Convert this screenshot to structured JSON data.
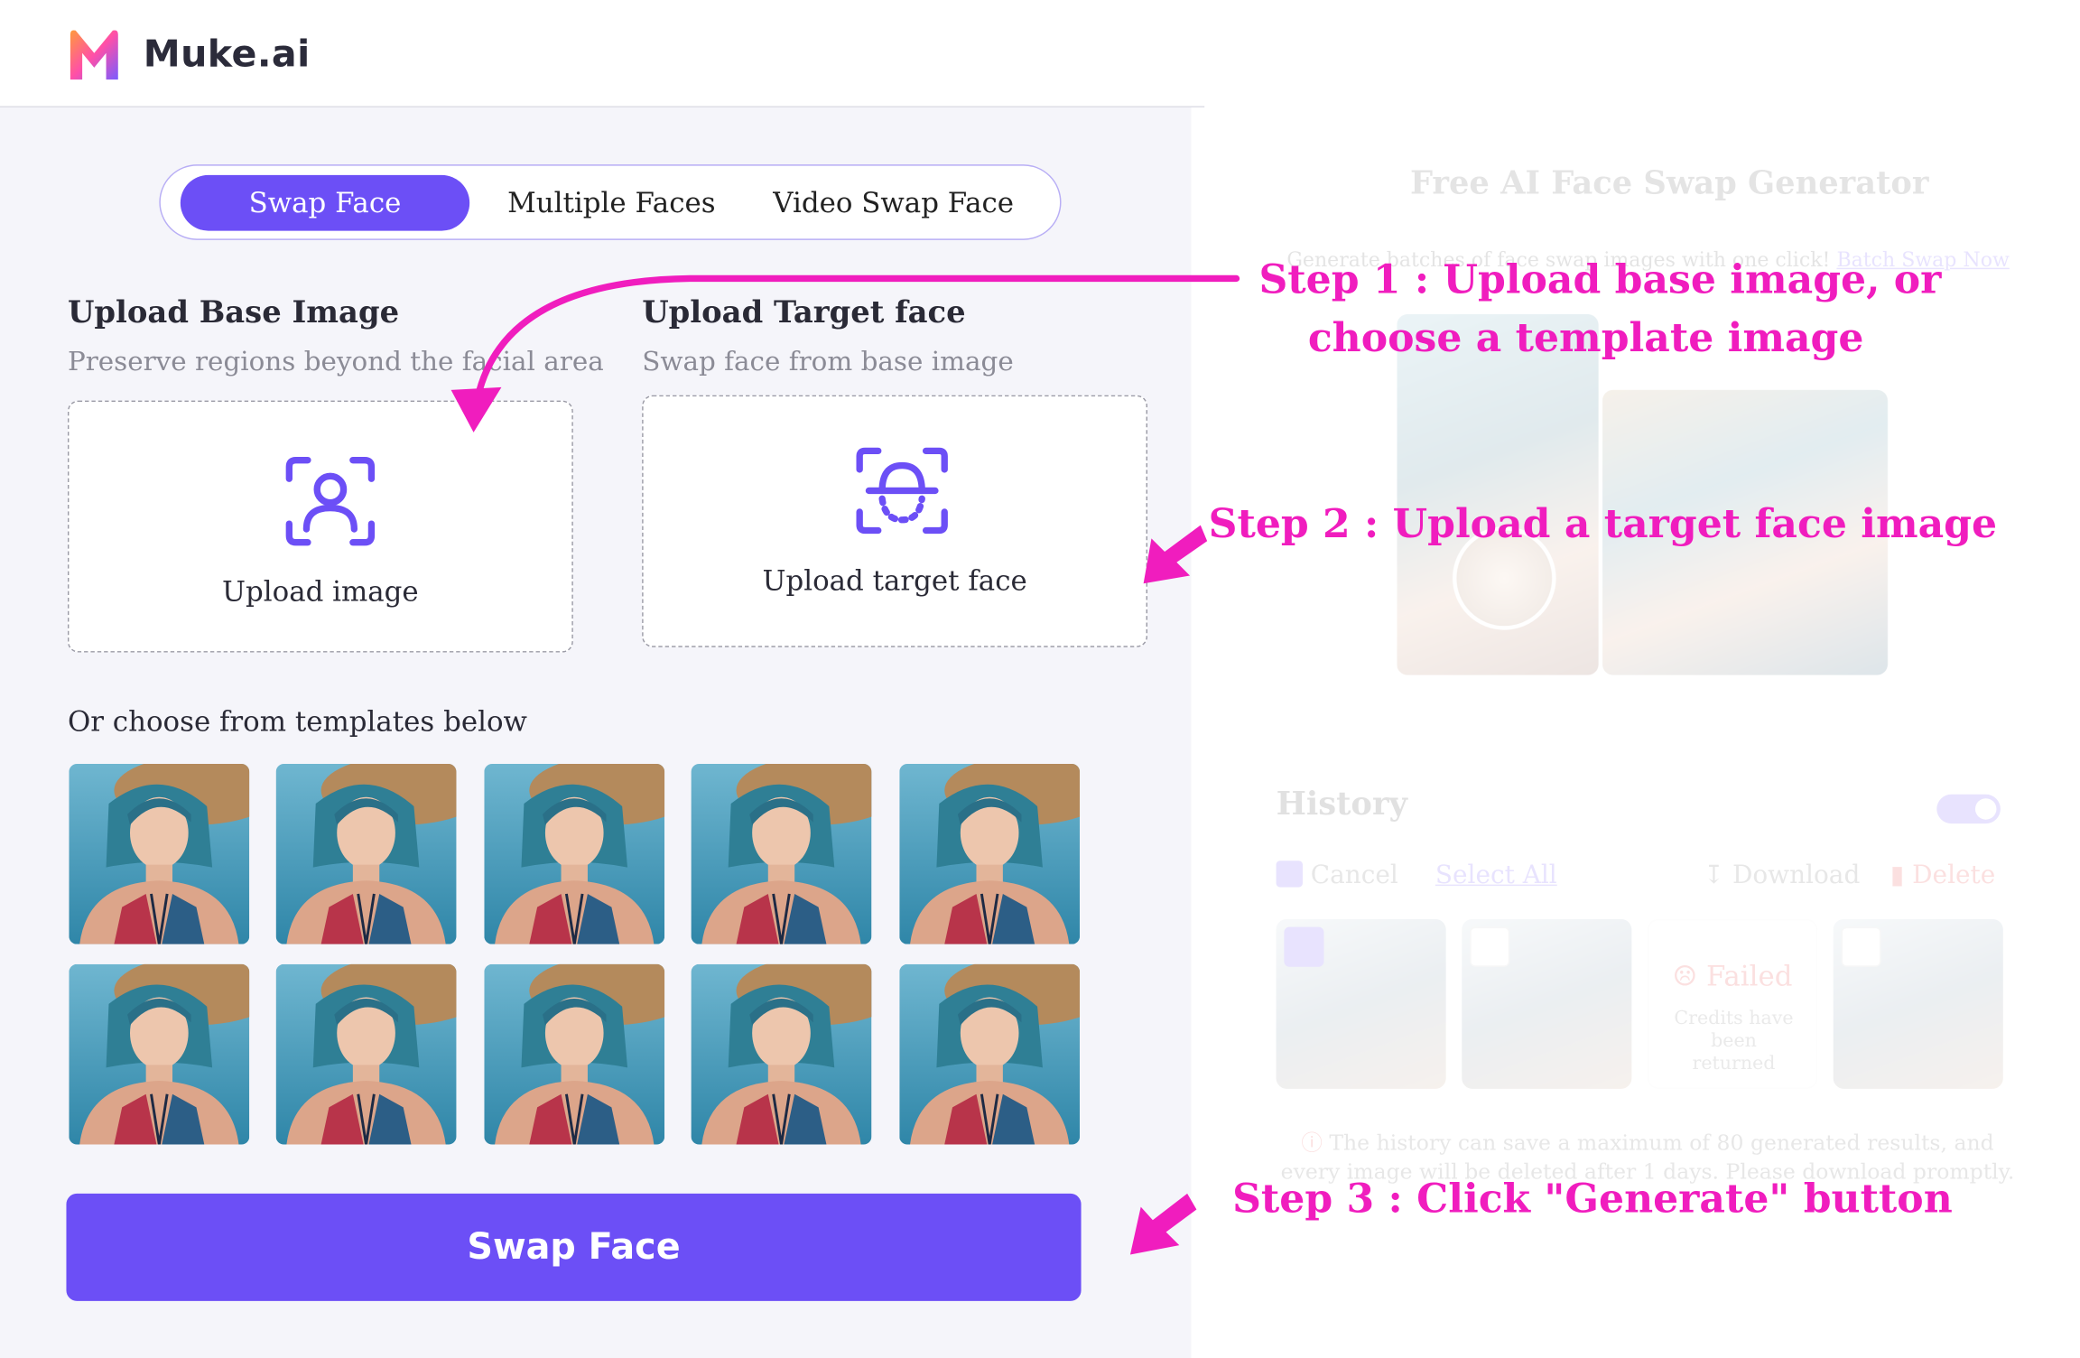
{
  "brand": {
    "name": "Muke.ai"
  },
  "tabs": [
    {
      "label": "Swap Face",
      "active": true
    },
    {
      "label": "Multiple Faces",
      "active": false
    },
    {
      "label": "Video Swap Face",
      "active": false
    }
  ],
  "base_upload": {
    "title": "Upload Base Image",
    "subtitle": "Preserve regions beyond the facial area",
    "label": "Upload image"
  },
  "target_upload": {
    "title": "Upload Target face",
    "subtitle": "Swap face from base image",
    "label": "Upload target face"
  },
  "templates": {
    "label": "Or choose from templates below",
    "count": 10
  },
  "primary_button": {
    "label": "Swap Face"
  },
  "right_panel": {
    "title": "Free AI Face Swap Generator",
    "promo_text": "Generate batches of face swap images with one click!",
    "promo_link": "Batch Swap Now",
    "history": {
      "title": "History",
      "cancel_label": "Cancel",
      "select_all_label": "Select All",
      "download_label": "Download",
      "delete_label": "Delete",
      "failed_label": "Failed",
      "failed_note": "Credits have been returned",
      "note": "The history can save a maximum of 80 generated results, and every image will be deleted after 1 days. Please download promptly."
    }
  },
  "annotations": {
    "step1_line1": "Step 1 : Upload base image, or",
    "step1_line2": "choose a template image",
    "step2": "Step 2 : Upload a target face image",
    "step3": "Step 3 : Click \"Generate\" button"
  },
  "colors": {
    "accent": "#6c4ff6",
    "annotation": "#f01dbe",
    "panel_bg": "#f5f5fa"
  }
}
